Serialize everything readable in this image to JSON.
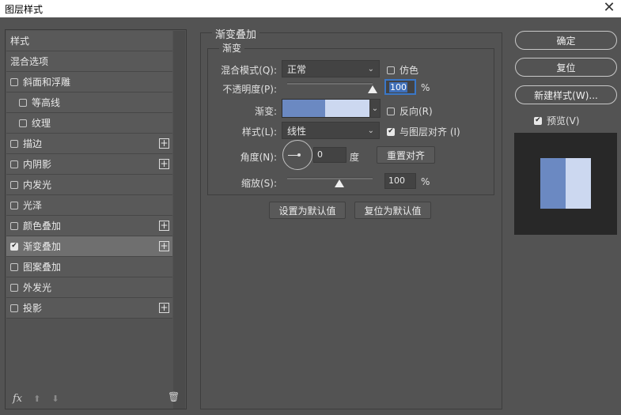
{
  "window": {
    "title": "图层样式",
    "close_glyph": "✕"
  },
  "sidebar": {
    "items": [
      {
        "label": "样式",
        "checkbox": false,
        "checked": false,
        "plus": false,
        "indent": 0
      },
      {
        "label": "混合选项",
        "checkbox": false,
        "checked": false,
        "plus": false,
        "indent": 0
      },
      {
        "label": "斜面和浮雕",
        "checkbox": true,
        "checked": false,
        "plus": false,
        "indent": 0
      },
      {
        "label": "等高线",
        "checkbox": true,
        "checked": false,
        "plus": false,
        "indent": 1
      },
      {
        "label": "纹理",
        "checkbox": true,
        "checked": false,
        "plus": false,
        "indent": 1
      },
      {
        "label": "描边",
        "checkbox": true,
        "checked": false,
        "plus": true,
        "indent": 0
      },
      {
        "label": "内阴影",
        "checkbox": true,
        "checked": false,
        "plus": true,
        "indent": 0
      },
      {
        "label": "内发光",
        "checkbox": true,
        "checked": false,
        "plus": false,
        "indent": 0
      },
      {
        "label": "光泽",
        "checkbox": true,
        "checked": false,
        "plus": false,
        "indent": 0
      },
      {
        "label": "颜色叠加",
        "checkbox": true,
        "checked": false,
        "plus": true,
        "indent": 0
      },
      {
        "label": "渐变叠加",
        "checkbox": true,
        "checked": true,
        "plus": true,
        "indent": 0,
        "selected": true
      },
      {
        "label": "图案叠加",
        "checkbox": true,
        "checked": false,
        "plus": false,
        "indent": 0
      },
      {
        "label": "外发光",
        "checkbox": true,
        "checked": false,
        "plus": false,
        "indent": 0
      },
      {
        "label": "投影",
        "checkbox": true,
        "checked": false,
        "plus": true,
        "indent": 0
      }
    ],
    "footer": {
      "fx_label": "fx",
      "up_glyph": "⬆",
      "down_glyph": "⬇",
      "trash_glyph": "🗑"
    }
  },
  "panel": {
    "group_title": "渐变叠加",
    "sub_title": "渐变",
    "blend_mode": {
      "label": "混合模式(Q):",
      "value": "正常",
      "dither_label": "仿色",
      "dither_checked": false
    },
    "opacity": {
      "label": "不透明度(P):",
      "value": "100",
      "unit": "%",
      "fraction": 1.0
    },
    "gradient": {
      "label": "渐变:",
      "reverse_label": "反向(R)",
      "reverse_checked": false,
      "color_start": "#6b89c2",
      "color_end": "#ccd8f0"
    },
    "style": {
      "label": "样式(L):",
      "value": "线性",
      "align_label": "与图层对齐 (I)",
      "align_checked": true
    },
    "angle": {
      "label": "角度(N):",
      "value": "0",
      "unit": "度",
      "reset_label": "重置对齐"
    },
    "scale": {
      "label": "缩放(S):",
      "value": "100",
      "unit": "%",
      "fraction": 0.5
    },
    "make_default_label": "设置为默认值",
    "reset_default_label": "复位为默认值"
  },
  "right": {
    "ok_label": "确定",
    "reset_label": "复位",
    "new_style_label": "新建样式(W)...",
    "preview_label": "预览(V)",
    "preview_checked": true,
    "preview_colors": {
      "left": "#6b89c2",
      "right": "#ccd8f0"
    }
  },
  "colors": {
    "selection": "#3f6fb8"
  }
}
